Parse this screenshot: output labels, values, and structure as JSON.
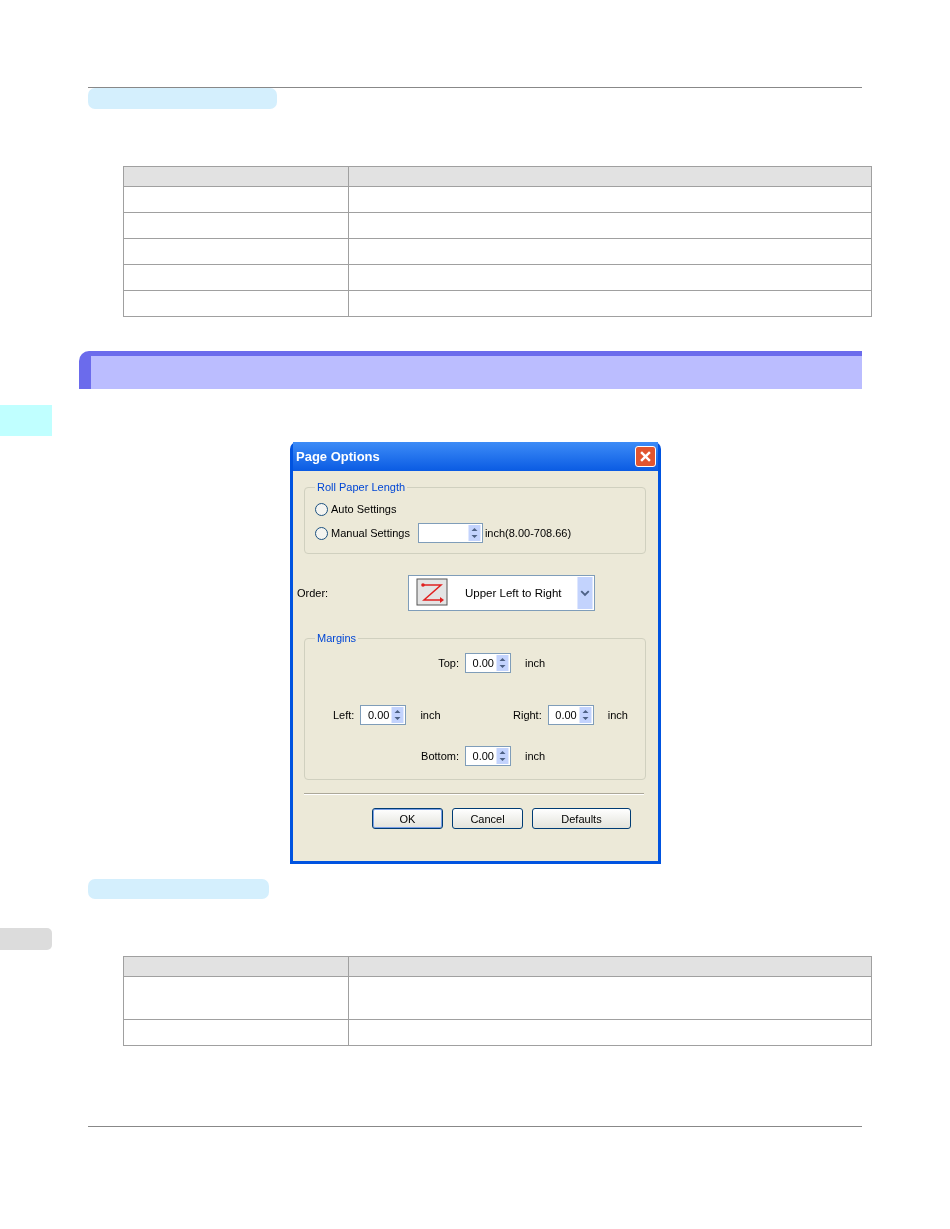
{
  "tables": [
    {
      "rows": [
        {
          "kind": "header"
        },
        {
          "kind": "single"
        },
        {
          "kind": "single"
        },
        {
          "kind": "single"
        },
        {
          "kind": "single"
        },
        {
          "kind": "single"
        }
      ]
    },
    {
      "rows": [
        {
          "kind": "header"
        },
        {
          "kind": "double"
        },
        {
          "kind": "single"
        }
      ]
    }
  ],
  "dialog": {
    "title": "Page Options",
    "roll_paper_length": {
      "label": "Roll Paper Length",
      "options": [
        {
          "label": "Auto Settings",
          "selected": false
        },
        {
          "label": "Manual Settings",
          "selected": false
        }
      ],
      "range": "inch(8.00-708.66)"
    },
    "order": {
      "label": "Order:",
      "value": "Upper Left to Right"
    },
    "margins": {
      "label": "Margins",
      "fields": [
        {
          "kind": "top",
          "label": "Top:",
          "value": "0.00",
          "unit": "inch"
        },
        {
          "kind": "left",
          "label": "Left:",
          "value": "0.00",
          "unit": "inch"
        },
        {
          "kind": "right",
          "label": "Right:",
          "value": "0.00",
          "unit": "inch"
        },
        {
          "kind": "bottom",
          "label": "Bottom:",
          "value": "0.00",
          "unit": "inch"
        }
      ]
    },
    "buttons": [
      {
        "label": "OK",
        "default": true
      },
      {
        "label": "Cancel",
        "default": false
      },
      {
        "label": "Defaults",
        "default": false
      }
    ]
  }
}
